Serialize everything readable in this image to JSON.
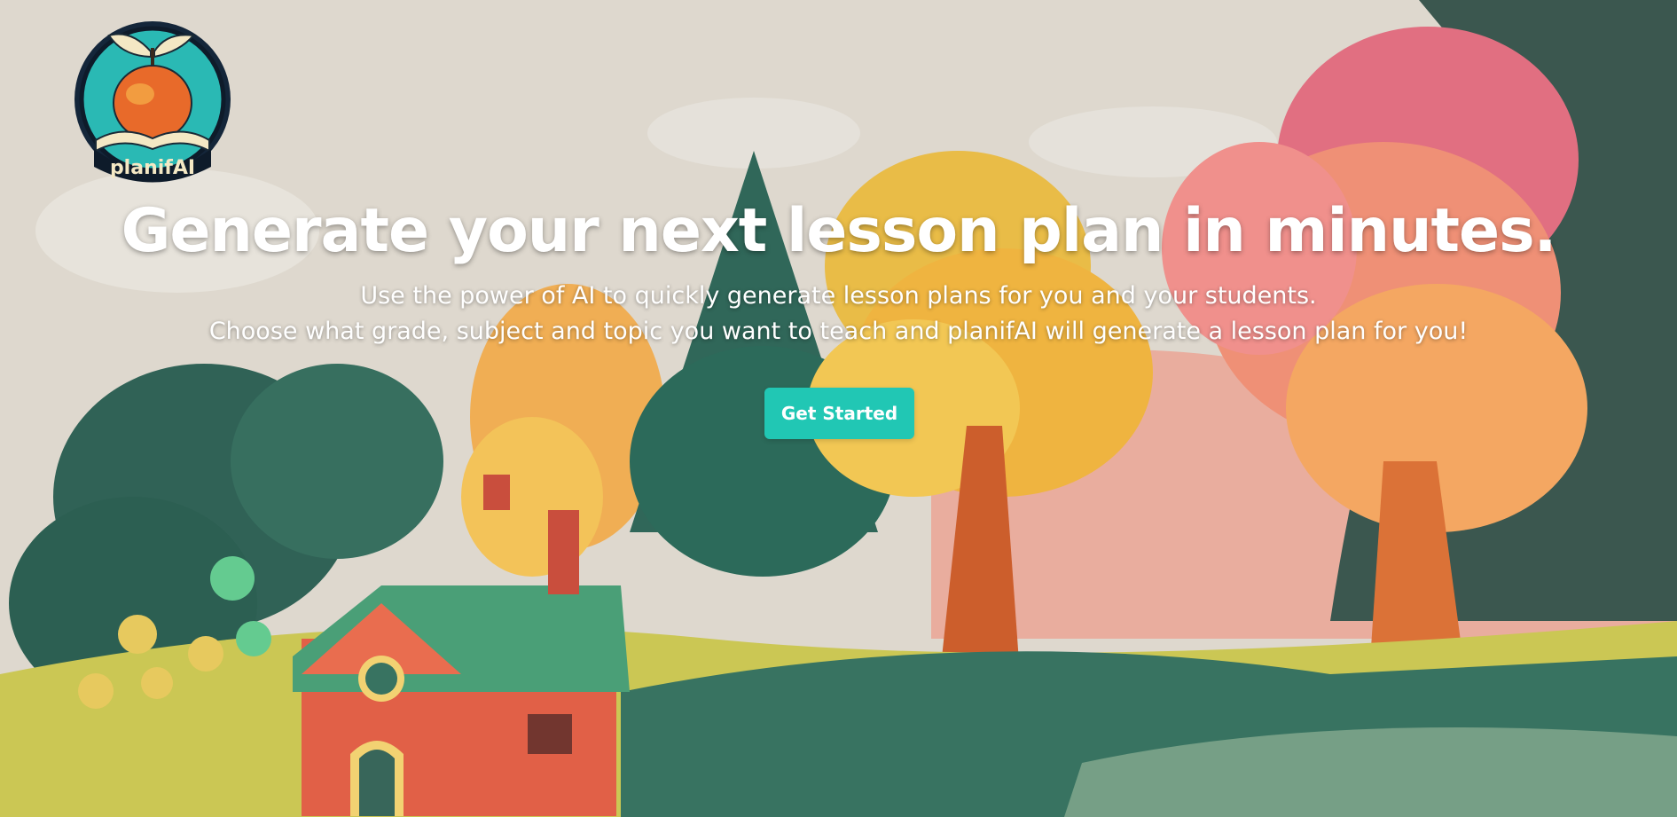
{
  "brand": {
    "logo_text": "planifAI",
    "icon": "apple-on-book-icon"
  },
  "hero": {
    "headline": "Generate your next lesson plan in minutes.",
    "subtitle_line1": "Use the power of AI to quickly generate lesson plans for you and your students.",
    "subtitle_line2": "Choose what grade, subject and topic you want to teach and planifAI will generate a lesson plan for you!",
    "cta_label": "Get Started"
  },
  "colors": {
    "accent": "#21c7b4",
    "text": "#ffffff",
    "sky": "#dcd6cc"
  }
}
